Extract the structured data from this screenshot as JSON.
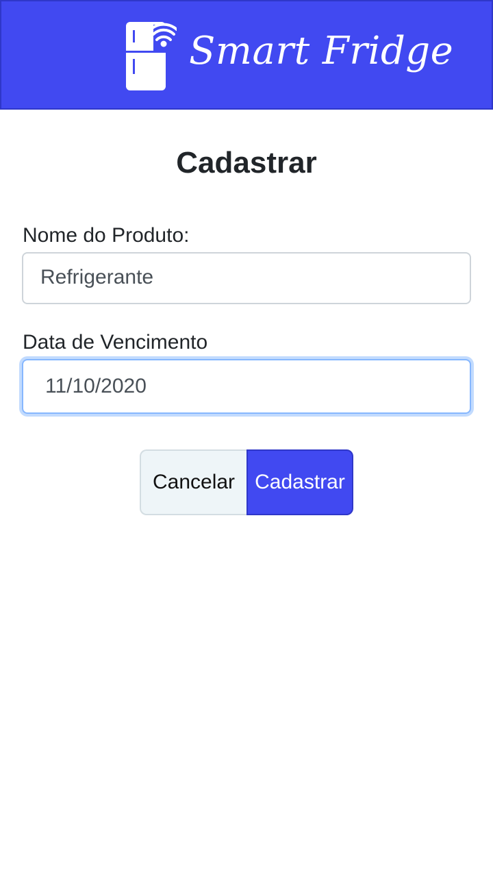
{
  "header": {
    "brand": "Smart Fridge",
    "logo_icon": "fridge-wifi-icon",
    "background_color": "#4149f1"
  },
  "page": {
    "title": "Cadastrar"
  },
  "form": {
    "product_name_label": "Nome do Produto:",
    "product_name_value": "Refrigerante",
    "expiry_label": "Data de Vencimento",
    "expiry_value": "11/10/2020"
  },
  "actions": {
    "cancel_label": "Cancelar",
    "submit_label": "Cadastrar",
    "submit_color": "#4149f1",
    "cancel_color": "#eef5f8"
  }
}
